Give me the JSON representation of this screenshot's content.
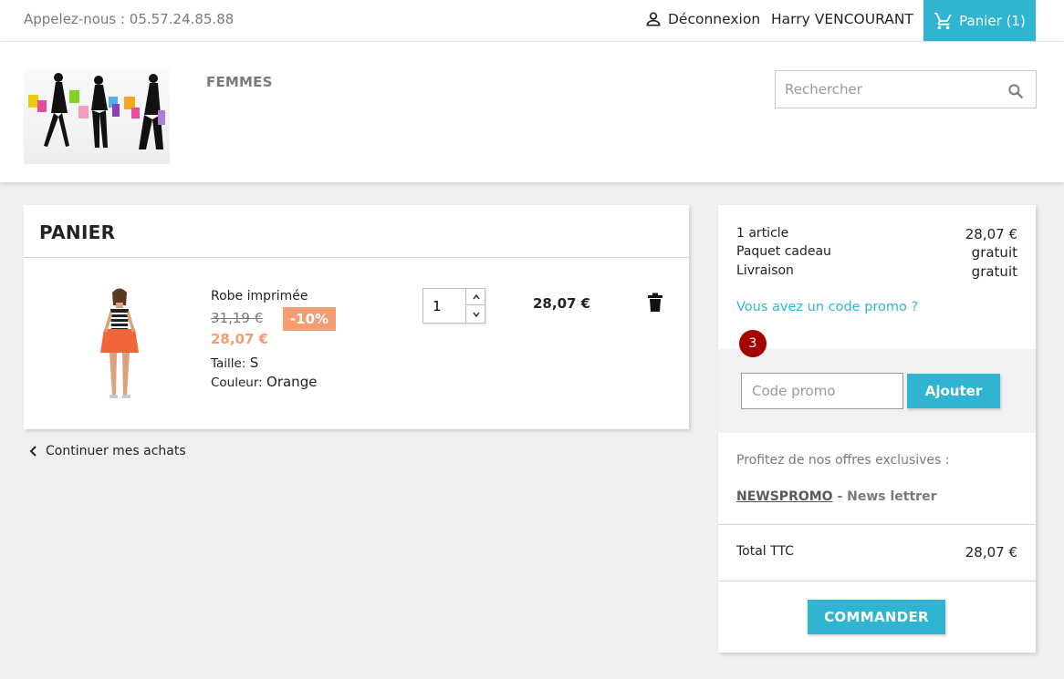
{
  "topbar": {
    "phone": "Appelez-nous : 05.57.24.85.88",
    "logout_label": "Déconnexion",
    "user_name": "Harry VENCOURANT",
    "cart_label": "Panier (1)"
  },
  "header": {
    "nav_item": "FEMMES",
    "search_placeholder": "Rechercher"
  },
  "cart": {
    "title": "PANIER",
    "items": [
      {
        "name": "Robe imprimée",
        "old_price": "31,19 €",
        "discount": "-10%",
        "price": "28,07 €",
        "size_label": "Taille:",
        "size_value": "S",
        "color_label": "Couleur:",
        "color_value": "Orange",
        "quantity": "1",
        "line_total": "28,07 €"
      }
    ],
    "continue_label": "Continuer mes achats"
  },
  "summary": {
    "rows": [
      {
        "label": "1 article",
        "value": "28,07 €"
      },
      {
        "label": "Paquet cadeau",
        "value": "gratuit"
      },
      {
        "label": "Livraison",
        "value": "gratuit"
      }
    ],
    "promo_link": "Vous avez un code promo ?",
    "step_badge": "3",
    "promo_placeholder": "Code promo",
    "add_label": "Ajouter",
    "offers_text": "Profitez de nos offres exclusives :",
    "offer_code": "NEWSPROMO",
    "offer_desc": " - News lettrer",
    "total_label": "Total TTC",
    "total_value": "28,07 €",
    "order_label": "COMMANDER"
  },
  "colors": {
    "accent": "#2fb5d2",
    "discount": "#f39d72",
    "badge": "#a30000"
  }
}
